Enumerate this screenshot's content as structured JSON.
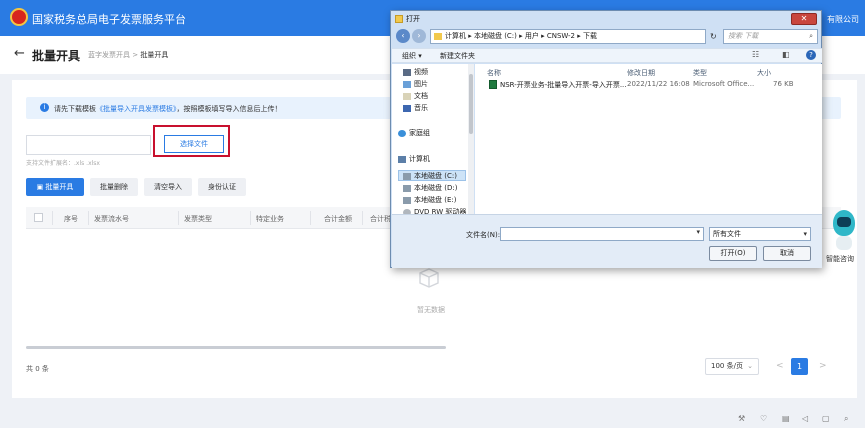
{
  "app": {
    "title": "国家税务总局电子发票服务平台",
    "company_fragment": "有限公司"
  },
  "page": {
    "back_icon": "←",
    "title": "批量开具",
    "breadcrumb": [
      "蓝字发票开具",
      ">",
      "批量开具"
    ]
  },
  "notice": {
    "icon": "i",
    "prefix": "请先下载模板",
    "link": "《批量导入开具发票模板》",
    "suffix": "，按照模板填写导入信息后上传！"
  },
  "upload": {
    "input_value": "",
    "choose_label": "选择文件",
    "hint": "支持文件扩展名：.xls .xlsx"
  },
  "actions": {
    "batch_issue": "批量开具",
    "batch_delete": "批量删除",
    "clear_import": "清空导入",
    "identity_auth": "身份认证"
  },
  "table": {
    "columns": [
      "序号",
      "发票流水号",
      "发票类型",
      "特定业务",
      "合计金额",
      "合计税额"
    ],
    "rows": [],
    "empty_text": "暂无数据"
  },
  "pagination": {
    "total": "共 0 条",
    "page_size": "100 条/页",
    "current_page": "1",
    "prev": "<",
    "next": ">"
  },
  "assistant": {
    "label": "智能咨询"
  },
  "file_dialog": {
    "title": "打开",
    "close": "✕",
    "path": "计算机 ▸ 本地磁盘 (C:) ▸ 用户 ▸ CNSW-2 ▸ 下载",
    "search_placeholder": "搜索 下载",
    "toolbar": {
      "organize": "组织 ▾",
      "new_folder": "新建文件夹",
      "help": "?"
    },
    "nav_items": [
      {
        "label": "视频",
        "icon": "video-icon"
      },
      {
        "label": "图片",
        "icon": "picture-icon"
      },
      {
        "label": "文档",
        "icon": "document-icon"
      },
      {
        "label": "音乐",
        "icon": "music-icon"
      },
      {
        "label": "家庭组",
        "icon": "homegroup-icon"
      },
      {
        "label": "计算机",
        "icon": "computer-icon"
      },
      {
        "label": "本地磁盘 (C:)",
        "icon": "drive-icon"
      },
      {
        "label": "本地磁盘 (D:)",
        "icon": "drive-icon"
      },
      {
        "label": "本地磁盘 (E:)",
        "icon": "drive-icon"
      },
      {
        "label": "DVD RW 驱动器",
        "icon": "dvd-icon"
      }
    ],
    "headers": [
      "名称",
      "修改日期",
      "类型",
      "大小"
    ],
    "files": [
      {
        "name": "NSR-开票业务-批量导入开票-导入开票...",
        "modified": "2022/11/22 16:08",
        "type": "Microsoft Office...",
        "size": "76 KB"
      }
    ],
    "filename_label": "文件名(N):",
    "filename_value": "",
    "filetype": "所有文件",
    "open_label": "打开(O)",
    "cancel_label": "取消"
  },
  "colors": {
    "brand": "#2a7be3",
    "highlight": "#c8102e"
  }
}
